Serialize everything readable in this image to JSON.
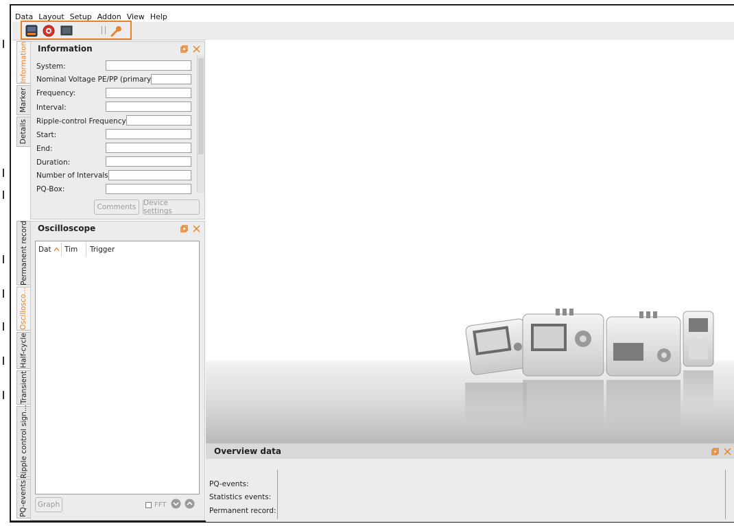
{
  "menu": {
    "items": [
      "Data",
      "Layout",
      "Setup",
      "Addon",
      "View",
      "Help"
    ]
  },
  "toolbar": {
    "icons": [
      "device-icon",
      "lifebuoy-icon",
      "monitor-icon",
      "wrench-icon"
    ],
    "highlight_color": "#e8822a"
  },
  "side_tabs_top": {
    "information": "Information",
    "marker": "Marker",
    "details": "Details"
  },
  "information": {
    "title": "Information",
    "labels": {
      "system": "System:",
      "nominal_voltage": "Nominal Voltage PE/PP (primary):",
      "frequency": "Frequency:",
      "interval": "Interval:",
      "ripple_frequency": "Ripple-control Frequency:",
      "start": "Start:",
      "end": "End:",
      "duration": "Duration:",
      "number_of_intervals": "Number of Intervals:",
      "pq_box": "PQ-Box:"
    },
    "comments_button": "Comments",
    "device_settings_button": "Device settings"
  },
  "side_tabs_bottom": {
    "permanent_record": "Permanent record",
    "oscilloscope": "Oscillosco...",
    "half_cycle": "Half-cycle",
    "transient": "Transient",
    "ripple_control": "Ripple control sign...",
    "pq_events": "PQ-events"
  },
  "oscilloscope": {
    "title": "Oscilloscope",
    "columns": {
      "date": "Dat",
      "time": "Tim",
      "trigger": "Trigger"
    },
    "graph_button": "Graph",
    "fft_label": "FFT"
  },
  "overview": {
    "title": "Overview data",
    "labels": {
      "pq_events": "PQ-events:",
      "statistics_events": "Statistics events:",
      "permanent_record": "Permanent record:"
    }
  },
  "colors": {
    "accent": "#e8822a",
    "panel_bg": "#ececec",
    "header_bg": "#d9d9d9"
  }
}
